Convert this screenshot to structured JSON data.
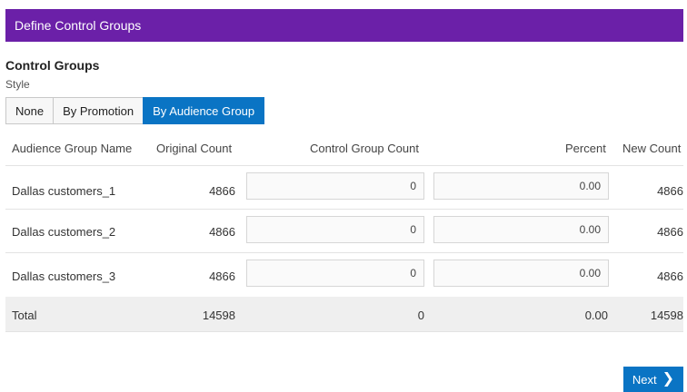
{
  "header": {
    "title": "Define Control Groups"
  },
  "section": {
    "title": "Control Groups",
    "style_label": "Style"
  },
  "style_options": [
    "None",
    "By Promotion",
    "By Audience Group"
  ],
  "style_selected": "By Audience Group",
  "table": {
    "columns": [
      "Audience Group Name",
      "Original Count",
      "Control Group Count",
      "Percent",
      "New Count"
    ],
    "rows": [
      {
        "name": "Dallas customers_1",
        "original": "4866",
        "control": "0",
        "percent": "0.00",
        "new": "4866"
      },
      {
        "name": "Dallas customers_2",
        "original": "4866",
        "control": "0",
        "percent": "0.00",
        "new": "4866"
      },
      {
        "name": "Dallas customers_3",
        "original": "4866",
        "control": "0",
        "percent": "0.00",
        "new": "4866"
      }
    ],
    "total": {
      "label": "Total",
      "original": "14598",
      "control": "0",
      "percent": "0.00",
      "new": "14598"
    }
  },
  "footer": {
    "next_label": "Next",
    "next_icon": "chevron-right-icon"
  },
  "colors": {
    "header": "#6b20a8",
    "accent": "#0a74c4"
  }
}
